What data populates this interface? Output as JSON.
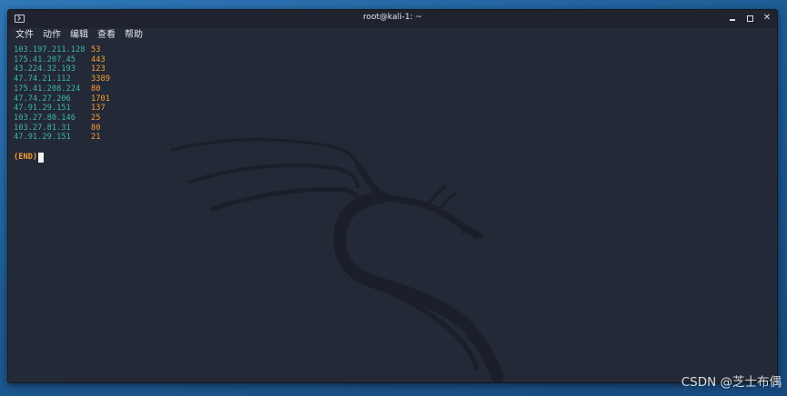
{
  "window": {
    "title": "root@kali-1: ~"
  },
  "menu": [
    {
      "label": "文件"
    },
    {
      "label": "动作"
    },
    {
      "label": "编辑"
    },
    {
      "label": "查看"
    },
    {
      "label": "帮助"
    }
  ],
  "terminal": {
    "rows": [
      {
        "ip": "103.197.211.128",
        "port": "53"
      },
      {
        "ip": "175.41.207.45",
        "port": "443"
      },
      {
        "ip": "43.224.32.193",
        "port": "123"
      },
      {
        "ip": "47.74.21.112",
        "port": "3389"
      },
      {
        "ip": "175.41.208.224",
        "port": "80"
      },
      {
        "ip": "47.74.27.206",
        "port": "1701"
      },
      {
        "ip": "47.91.29.151",
        "port": "137"
      },
      {
        "ip": "103.27.80.146",
        "port": "25"
      },
      {
        "ip": "103.27.81.31",
        "port": "80"
      },
      {
        "ip": "47.91.29.151",
        "port": "21"
      }
    ],
    "end_marker": "(END)"
  },
  "colors": {
    "ip": "#3fb5a3",
    "port": "#f59e3a",
    "background": "#232936"
  },
  "watermark": "CSDN @芝士布偶"
}
